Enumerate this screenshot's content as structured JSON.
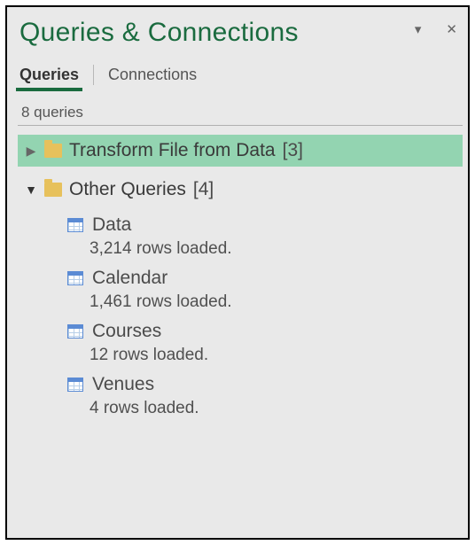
{
  "header": {
    "title": "Queries & Connections"
  },
  "tabs": [
    {
      "label": "Queries",
      "active": true
    },
    {
      "label": "Connections",
      "active": false
    }
  ],
  "summary": "8 queries",
  "groups": [
    {
      "name": "Transform File from Data",
      "count_display": "[3]",
      "expanded": false,
      "selected": true,
      "items": []
    },
    {
      "name": "Other Queries",
      "count_display": "[4]",
      "expanded": true,
      "selected": false,
      "items": [
        {
          "name": "Data",
          "status": "3,214 rows loaded."
        },
        {
          "name": "Calendar",
          "status": "1,461 rows loaded."
        },
        {
          "name": "Courses",
          "status": "12 rows loaded."
        },
        {
          "name": "Venues",
          "status": "4 rows loaded."
        }
      ]
    }
  ]
}
